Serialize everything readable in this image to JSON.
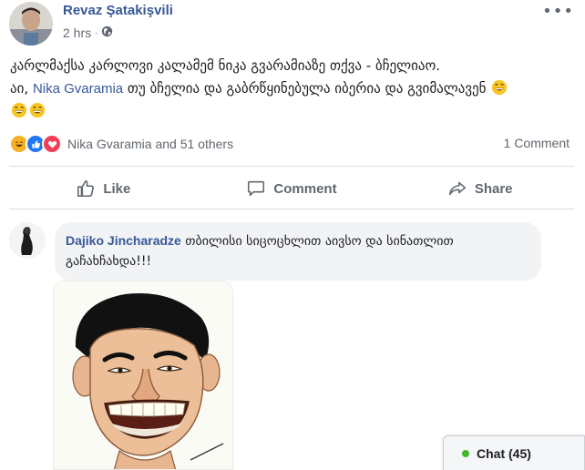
{
  "post": {
    "author": "Revaz Şatakişvili",
    "time": "2 hrs",
    "privacy_icon": "globe-icon",
    "more_icon": "•••",
    "text_line1": "კარლმაქსა კარლოვი კალამემ ნიკა გვარამიაზე თქვა - ბჩელიაო.",
    "text_line2_prefix": "აი,",
    "mention": "Nika Gvaramia",
    "text_line2_suffix": "თუ ბჩელია და გაბრწყინებულა იბერია და გვიმალავენ",
    "reactions_text": "Nika Gvaramia and 51 others",
    "comment_count": "1 Comment",
    "actions": {
      "like": "Like",
      "comment": "Comment",
      "share": "Share"
    }
  },
  "comment": {
    "author": "Dajiko Jincharadze",
    "text": "თბილისი სიცოცხლით აივსო და სინათლით გაჩახჩახდა!!!"
  },
  "chat": {
    "label": "Chat (45)",
    "status_color": "#42b72a"
  },
  "colors": {
    "link": "#385898",
    "muted": "#606770",
    "like_blue": "#2078f4",
    "love_red": "#f33e58",
    "haha_yellow": "#f7b125"
  }
}
